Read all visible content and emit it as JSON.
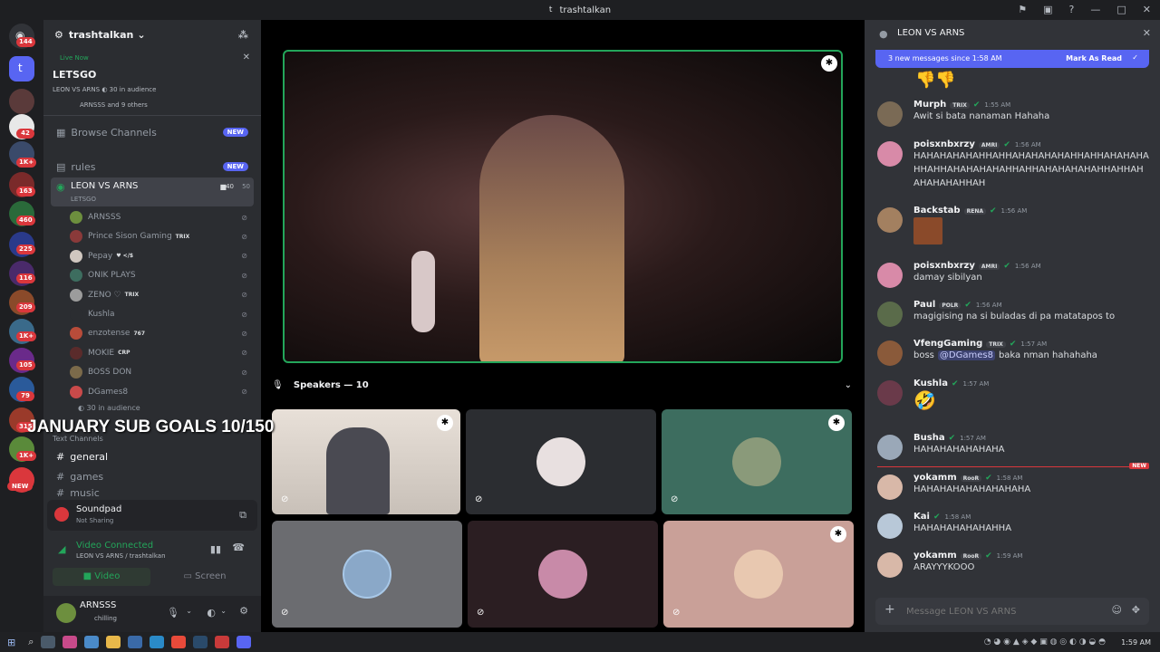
{
  "window": {
    "title": "trashtalkan",
    "icon_letter": "t"
  },
  "rail": {
    "badges": [
      "144",
      "42",
      "1K+",
      "163",
      "460",
      "225",
      "116",
      "209",
      "1K+",
      "105",
      "79",
      "315",
      "1K+"
    ],
    "new_label": "NEW"
  },
  "guild": {
    "name": "trashtalkan"
  },
  "live": {
    "label": "Live Now",
    "title": "LETSGO",
    "channel": "LEON VS ARNS",
    "audience": "30 in audience",
    "participants": "ARNSSS and 9 others"
  },
  "channels": {
    "browse": "Browse Channels",
    "rules": "rules",
    "new_label": "NEW",
    "voice_name": "LEON VS ARNS",
    "voice_sub": "LETSGO",
    "voice_count_a": "40",
    "voice_count_b": "50",
    "text_header": "Text Channels",
    "general": "general",
    "games": "games",
    "music": "music"
  },
  "voice_users": [
    {
      "name": "ARNSSS",
      "tag": "",
      "color": "#6d8f3e"
    },
    {
      "name": "Prince Sison Gaming",
      "tag": "TRIX",
      "color": "#8a3a3a"
    },
    {
      "name": "Pepay",
      "tag": "♥ </$",
      "color": "#d0c7c0"
    },
    {
      "name": "ONIK PLAYS",
      "tag": "",
      "color": "#3d6d5f"
    },
    {
      "name": "ZENO ♡",
      "tag": "TRIX",
      "color": "#9c9c9c"
    },
    {
      "name": "Kushla",
      "tag": "",
      "color": "#2b2d31"
    },
    {
      "name": "enzotense",
      "tag": "767",
      "color": "#b84c3a"
    },
    {
      "name": "MOKIE",
      "tag": "CRP",
      "color": "#5a2b2b"
    },
    {
      "name": "BOSS DON",
      "tag": "",
      "color": "#7b6a4a"
    },
    {
      "name": "DGames8",
      "tag": "",
      "color": "#c94a4a"
    }
  ],
  "audience_label": "30 in audience",
  "overlay_text": "JANUARY SUB GOALS 10/150",
  "soundpad": {
    "title": "Soundpad",
    "status": "Not Sharing"
  },
  "connection": {
    "status": "Video Connected",
    "location": "LEON VS ARNS / trashtalkan",
    "video_label": "Video",
    "screen_label": "Screen"
  },
  "user": {
    "name": "ARNSSS",
    "status": "chilling"
  },
  "stage": {
    "speakers_label": "Speakers — 10"
  },
  "chat": {
    "channel": "LEON VS ARNS",
    "banner_text": "3 new messages since 1:58 AM",
    "mark_read": "Mark As Read",
    "new_label": "NEW",
    "input_placeholder": "Message LEON VS ARNS",
    "messages": [
      {
        "name": "Murph",
        "tag": "TRIX",
        "time": "1:55 AM",
        "text": "Awit si bata nanaman Hahaha",
        "color": "#7a6a55"
      },
      {
        "name": "poisxnbxrzy",
        "tag": "AMRI",
        "time": "1:56 AM",
        "text": "HAHAHAHAHAHHAHHAHAHAHAHAHHAHHAHAHAHAHHAHHAHAHAHAHAHHAHHAHAHAHAHAHHAHHAHAHAHAHAHHAH",
        "color": "#d88aa8"
      },
      {
        "name": "Backstab",
        "tag": "RENA",
        "time": "1:56 AM",
        "text": "",
        "color": "#a38060"
      },
      {
        "name": "poisxnbxrzy",
        "tag": "AMRI",
        "time": "1:56 AM",
        "text": "damay sibilyan",
        "color": "#d88aa8"
      },
      {
        "name": "Paul",
        "tag": "POLR",
        "time": "1:56 AM",
        "text": "magigising na si buladas di pa matatapos to",
        "color": "#5a6b4a"
      },
      {
        "name": "VfengGaming",
        "tag": "TRIX",
        "time": "1:57 AM",
        "text": "boss",
        "mention": "@DGames8",
        "text2": "baka nman hahahaha",
        "color": "#8a5a3a"
      },
      {
        "name": "Kushla",
        "tag": "",
        "time": "1:57 AM",
        "text": "🤣",
        "color": "#6a3a4a"
      },
      {
        "name": "Busha",
        "tag": "",
        "time": "1:57 AM",
        "text": "HAHAHAHAHAHAHA",
        "color": "#9aa8b8"
      },
      {
        "name": "yokamm",
        "tag": "RooR",
        "time": "1:58 AM",
        "text": "HAHAHAHAHAHAHAHAHA",
        "color": "#d8b8a8"
      },
      {
        "name": "Kai",
        "tag": "",
        "time": "1:58 AM",
        "text": "HAHAHAHAHAHAHHA",
        "color": "#b8c8d8"
      },
      {
        "name": "yokamm",
        "tag": "RooR",
        "time": "1:59 AM",
        "text": "ARAYYYKOOO",
        "color": "#d8b8a8"
      }
    ]
  },
  "taskbar": {
    "time": "1:59 AM"
  },
  "colors": {
    "accent": "#5865f2",
    "green": "#23a55a",
    "bg": "#1e1f22",
    "sidebar": "#2b2d31",
    "chat": "#313338"
  }
}
